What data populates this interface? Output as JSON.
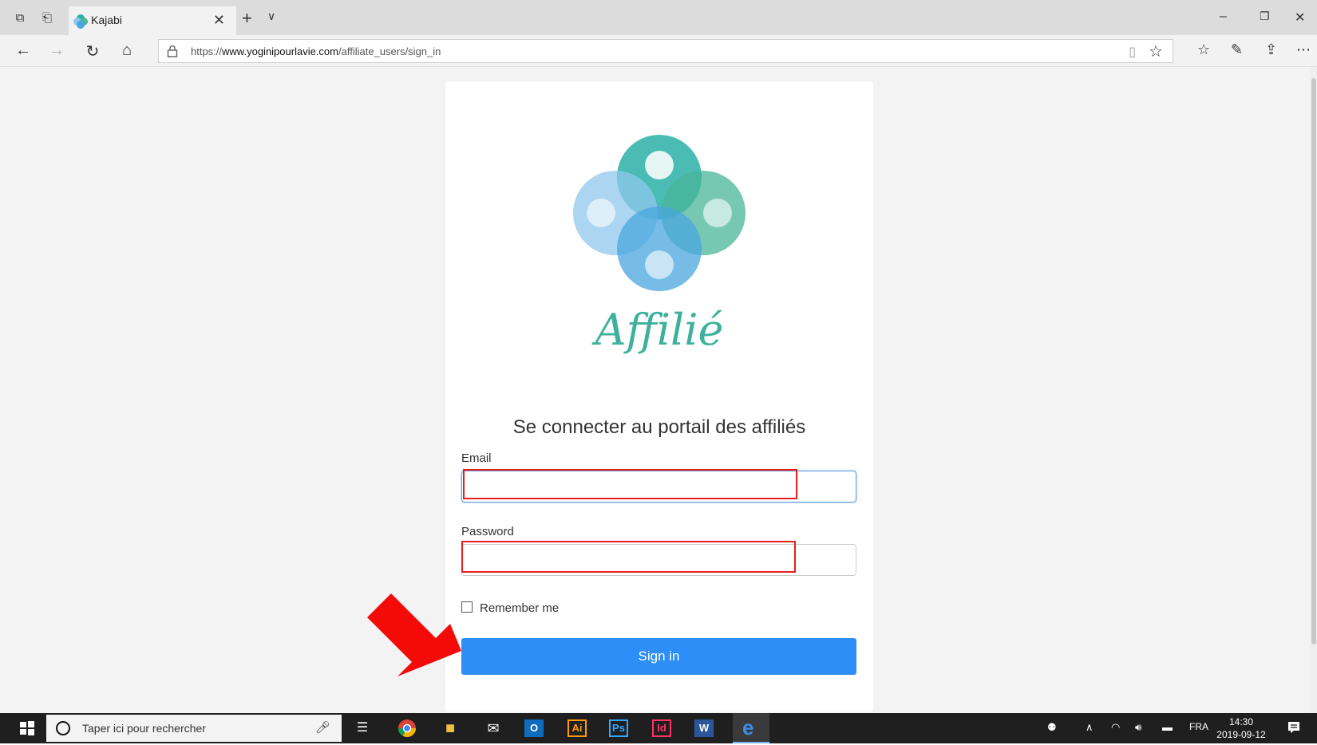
{
  "browser": {
    "tab_title": "Kajabi",
    "url_prefix": "https://",
    "url_domain": "www.yoginipourlavie.com",
    "url_path": "/affiliate_users/sign_in"
  },
  "logo": {
    "text": "Affilié",
    "colors": [
      "#2ab0a6",
      "#8fc7ec",
      "#4ab59a",
      "#4aa6df"
    ]
  },
  "form": {
    "heading": "Se connecter au portail des affiliés",
    "email_label": "Email",
    "email_value": "",
    "password_label": "Password",
    "password_value": "",
    "remember_label": "Remember me",
    "remember_checked": false,
    "signin_label": "Sign in"
  },
  "taskbar": {
    "search_placeholder": "Taper ici pour rechercher",
    "language": "FRA",
    "time": "14:30",
    "date": "2019-09-12"
  },
  "colors": {
    "accent": "#2d8ef7",
    "highlight": "#e61e1e",
    "arrow": "#f50a0a"
  }
}
